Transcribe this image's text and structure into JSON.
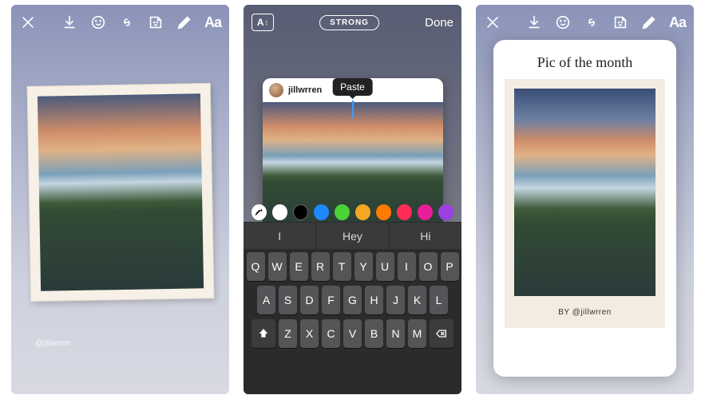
{
  "panel1": {
    "toolbar": {
      "text_tool": "Aa"
    },
    "watermark": "@jillwrren"
  },
  "panel2": {
    "toolbar": {
      "style_label": "STRONG",
      "done": "Done"
    },
    "card": {
      "username": "jillwrren"
    },
    "tooltip": "Paste",
    "colors": {
      "white": "#ffffff",
      "black": "#000000",
      "blue": "#1e88ff",
      "green": "#4cd137",
      "gold": "#f5a623",
      "orange": "#ff7a00",
      "red": "#ff2d55",
      "magenta": "#e91e98",
      "purple": "#9b3fe0"
    },
    "suggestions": [
      "I",
      "Hey",
      "Hi"
    ],
    "keyboard": {
      "row1": [
        "Q",
        "W",
        "E",
        "R",
        "T",
        "Y",
        "U",
        "I",
        "O",
        "P"
      ],
      "row2": [
        "A",
        "S",
        "D",
        "F",
        "G",
        "H",
        "J",
        "K",
        "L"
      ],
      "row3": [
        "Z",
        "X",
        "C",
        "V",
        "B",
        "N",
        "M"
      ]
    }
  },
  "panel3": {
    "toolbar": {
      "text_tool": "Aa"
    },
    "card": {
      "title": "Pic of the month",
      "caption": "BY @jillwrren"
    }
  }
}
